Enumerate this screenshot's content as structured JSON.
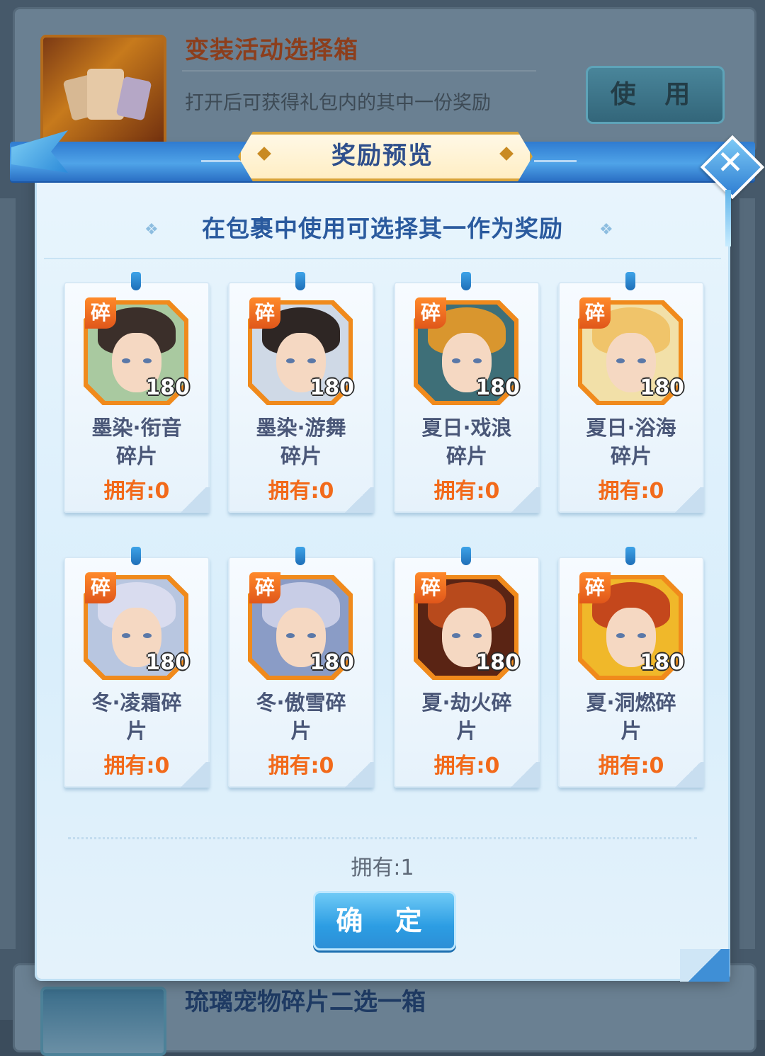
{
  "background_item": {
    "title": "变装活动选择箱",
    "description": "打开后可获得礼包内的其中一份奖励",
    "use_label": "使 用"
  },
  "background_item_bottom": {
    "title": "琉璃宠物碎片二选一箱"
  },
  "modal": {
    "title": "奖励预览",
    "close_label": "✕",
    "subtitle": "在包裹中使用可选择其一作为奖励",
    "owned_total": "拥有:1",
    "confirm_label": "确 定"
  },
  "rewards": [
    {
      "badge": "碎",
      "count": "180",
      "name_line1": "墨染·衔音",
      "name_line2": "碎片",
      "owned": "拥有:0",
      "hair_color": "#3b2f2a",
      "bg_color": "#a9c9a0"
    },
    {
      "badge": "碎",
      "count": "180",
      "name_line1": "墨染·游舞",
      "name_line2": "碎片",
      "owned": "拥有:0",
      "hair_color": "#2e2624",
      "bg_color": "#cfd9e6"
    },
    {
      "badge": "碎",
      "count": "180",
      "name_line1": "夏日·戏浪",
      "name_line2": "碎片",
      "owned": "拥有:0",
      "hair_color": "#d9962e",
      "bg_color": "#3e6f78"
    },
    {
      "badge": "碎",
      "count": "180",
      "name_line1": "夏日·浴海",
      "name_line2": "碎片",
      "owned": "拥有:0",
      "hair_color": "#f0c46a",
      "bg_color": "#f2e0a8"
    },
    {
      "badge": "碎",
      "count": "180",
      "name_line1": "冬·凌霜碎",
      "name_line2": "片",
      "owned": "拥有:0",
      "hair_color": "#d9dcef",
      "bg_color": "#b8c6e0"
    },
    {
      "badge": "碎",
      "count": "180",
      "name_line1": "冬·傲雪碎",
      "name_line2": "片",
      "owned": "拥有:0",
      "hair_color": "#c8cde6",
      "bg_color": "#8a9cc6"
    },
    {
      "badge": "碎",
      "count": "180",
      "name_line1": "夏·劫火碎",
      "name_line2": "片",
      "owned": "拥有:0",
      "hair_color": "#b84a1c",
      "bg_color": "#5a2414"
    },
    {
      "badge": "碎",
      "count": "180",
      "name_line1": "夏·洞燃碎",
      "name_line2": "片",
      "owned": "拥有:0",
      "hair_color": "#c4471c",
      "bg_color": "#f0b82a"
    }
  ]
}
